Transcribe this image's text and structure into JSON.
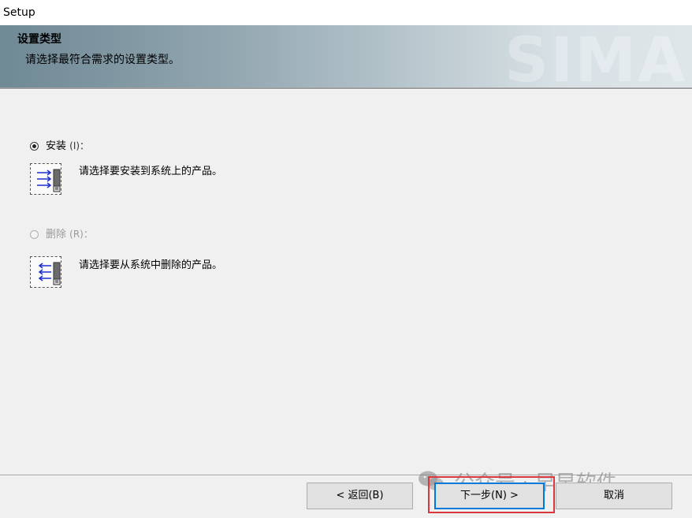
{
  "window": {
    "title": "Setup"
  },
  "header": {
    "title": "设置类型",
    "subtitle": "请选择最符合需求的设置类型。",
    "watermark": "SIMA"
  },
  "options": [
    {
      "label": "安装",
      "mnemonic": "(I)：",
      "description": "请选择要安装到系统上的产品。",
      "selected": true,
      "enabled": true,
      "icon": "install-icon"
    },
    {
      "label": "删除",
      "mnemonic": "(R)：",
      "description": "请选择要从系统中删除的产品。",
      "selected": false,
      "enabled": false,
      "icon": "remove-icon"
    }
  ],
  "buttons": {
    "back": "< 返回(B)",
    "next": "下一步(N) >",
    "cancel": "取消"
  },
  "overlay": {
    "icon": "wechat-icon",
    "text": "公众号 · 早早软件"
  },
  "colors": {
    "highlight": "#d9363e",
    "focus": "#0078d7",
    "arrow": "#1a2fd0"
  }
}
